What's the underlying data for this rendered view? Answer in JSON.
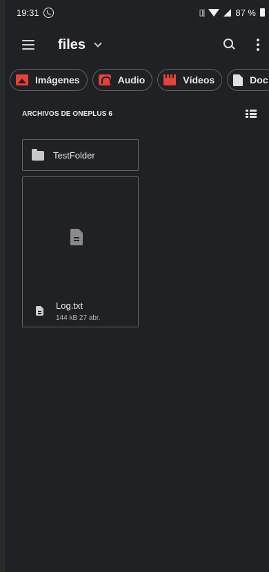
{
  "status_bar": {
    "time": "19:31",
    "vibrate": "▯|",
    "battery": "87 %"
  },
  "app_bar": {
    "title": "files"
  },
  "chips": [
    {
      "label": "Imágenes",
      "icon": "image-icon",
      "color": "#e5423b"
    },
    {
      "label": "Audio",
      "icon": "headphones-icon",
      "color": "#e5423b"
    },
    {
      "label": "Vídeos",
      "icon": "clapperboard-icon",
      "color": "#e5423b"
    },
    {
      "label": "Doc",
      "icon": "document-icon",
      "color": "#e0e0e0"
    }
  ],
  "section": {
    "title": "ARCHIVOS DE ONEPLUS 6"
  },
  "folders": [
    {
      "name": "TestFolder"
    }
  ],
  "files": [
    {
      "name": "Log.txt",
      "meta": "144 kB 27 abr."
    }
  ],
  "colors": {
    "background": "#202124",
    "border": "#5f6368",
    "accent": "#e5423b"
  }
}
